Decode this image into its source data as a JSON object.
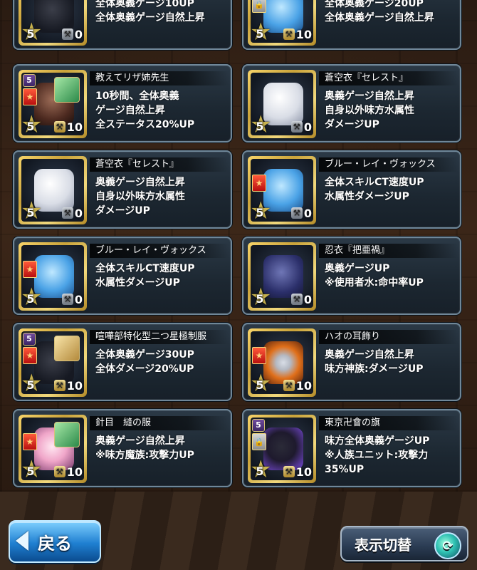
{
  "top_partial": [
    {
      "rarity": "5",
      "lock": false,
      "hammer_type": "silver",
      "level": "0",
      "desc": [
        "全体奥義ゲージ10UP",
        "全体奥義ゲージ自然上昇"
      ]
    },
    {
      "rarity": "5",
      "lock": true,
      "hammer_type": "gold",
      "level": "10",
      "desc": [
        "全体奥義ゲージ20UP",
        "全体奥義ゲージ自然上昇"
      ]
    }
  ],
  "cards": [
    {
      "title": "教えてリザ姉先生",
      "rarity_top": "5",
      "flag": true,
      "lock": false,
      "chara": "green",
      "art": "brown",
      "star": "5",
      "hammer_type": "gold",
      "level": "10",
      "desc": [
        "10秒間、全体奥義",
        "ゲージ自然上昇",
        "全ステータス20%UP"
      ]
    },
    {
      "title": "蒼空衣『セレスト』",
      "rarity_top": "",
      "flag": false,
      "lock": false,
      "chara": "",
      "art": "white",
      "star": "5",
      "hammer_type": "silver",
      "level": "0",
      "desc": [
        "奥義ゲージ自然上昇",
        "自身以外味方水属性",
        "ダメージUP"
      ]
    },
    {
      "title": "蒼空衣『セレスト』",
      "rarity_top": "",
      "flag": false,
      "lock": false,
      "chara": "",
      "art": "white",
      "star": "5",
      "hammer_type": "silver",
      "level": "0",
      "desc": [
        "奥義ゲージ自然上昇",
        "自身以外味方水属性",
        "ダメージUP"
      ]
    },
    {
      "title": "ブルー・レイ・ヴォックス",
      "rarity_top": "",
      "flag": true,
      "lock": false,
      "chara": "",
      "art": "blue",
      "star": "5",
      "hammer_type": "silver",
      "level": "0",
      "desc": [
        "全体スキルCT速度UP",
        "水属性ダメージUP"
      ]
    },
    {
      "title": "ブルー・レイ・ヴォックス",
      "rarity_top": "",
      "flag": true,
      "lock": false,
      "chara": "",
      "art": "blue",
      "star": "5",
      "hammer_type": "silver",
      "level": "0",
      "desc": [
        "全体スキルCT速度UP",
        "水属性ダメージUP"
      ]
    },
    {
      "title": "忍衣『把亜禍』",
      "rarity_top": "",
      "flag": false,
      "lock": false,
      "chara": "",
      "art": "navy",
      "star": "5",
      "hammer_type": "silver",
      "level": "0",
      "desc": [
        "奥義ゲージUP",
        "※使用者水:命中率UP"
      ]
    },
    {
      "title": "喧嘩部特化型二つ星極制服",
      "rarity_top": "5",
      "flag": true,
      "lock": false,
      "chara": "blonde",
      "art": "dark",
      "star": "5",
      "hammer_type": "gold",
      "level": "10",
      "desc": [
        "全体奥義ゲージ30UP",
        "全体ダメージ20%UP"
      ]
    },
    {
      "title": "ハオの耳飾り",
      "rarity_top": "",
      "flag": true,
      "lock": false,
      "chara": "",
      "art": "orange",
      "star": "5",
      "hammer_type": "gold",
      "level": "10",
      "desc": [
        "奥義ゲージ自然上昇",
        "味方神族:ダメージUP"
      ]
    },
    {
      "title": "針目　縫の服",
      "rarity_top": "",
      "flag": true,
      "lock": false,
      "chara": "green",
      "art": "pink",
      "star": "5",
      "hammer_type": "gold",
      "level": "10",
      "desc": [
        "奥義ゲージ自然上昇",
        "※味方魔族:攻撃力UP"
      ]
    },
    {
      "title": "東京卍會の旗",
      "rarity_top": "5",
      "flag": false,
      "lock": true,
      "chara": "",
      "art": "purple",
      "star": "5",
      "hammer_type": "gold",
      "level": "10",
      "desc": [
        "味方全体奥義ゲージUP",
        "※人族ユニット:攻撃力",
        "35%UP"
      ]
    }
  ],
  "buttons": {
    "back_label": "戻る",
    "toggle_label": "表示切替"
  },
  "icons": {
    "hammer": "hammer-icon",
    "star": "star-icon",
    "flag": "flag-icon",
    "lock": "lock-icon",
    "cycle": "cycle-icon",
    "back_arrow": "back-arrow-icon"
  },
  "colors": {
    "card_border": "#6f8799",
    "thumb_gold": "#caa33a",
    "back_button": "#1f7fd1",
    "toggle_button": "#2a3b52"
  }
}
